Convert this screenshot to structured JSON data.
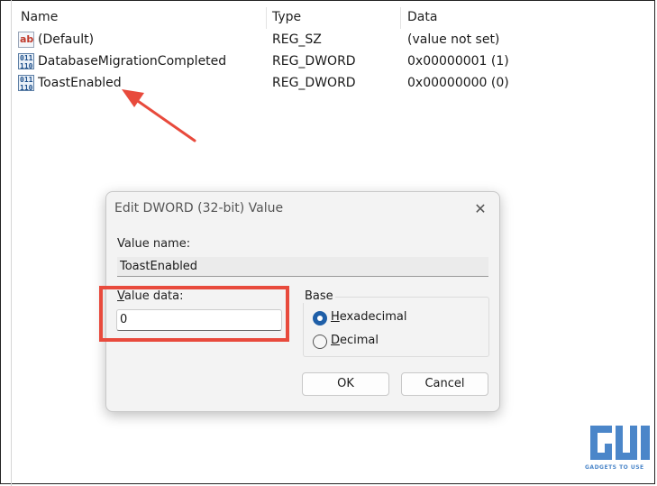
{
  "list": {
    "headers": {
      "name": "Name",
      "type": "Type",
      "data": "Data"
    },
    "rows": [
      {
        "icon": "string-value-icon",
        "icon_text": "ab",
        "name": "(Default)",
        "type": "REG_SZ",
        "data": "(value not set)"
      },
      {
        "icon": "dword-value-icon",
        "icon_text": "011\n110",
        "name": "DatabaseMigrationCompleted",
        "type": "REG_DWORD",
        "data": "0x00000001 (1)"
      },
      {
        "icon": "dword-value-icon",
        "icon_text": "011\n110",
        "name": "ToastEnabled",
        "type": "REG_DWORD",
        "data": "0x00000000 (0)"
      }
    ]
  },
  "dialog": {
    "title": "Edit DWORD (32-bit) Value",
    "value_name_label": "Value name:",
    "value_name": "ToastEnabled",
    "value_data_label_first": "V",
    "value_data_label_rest": "alue data:",
    "value_data": "0",
    "base_label": "Base",
    "radio_hex_first": "H",
    "radio_hex_rest": "exadecimal",
    "radio_dec_first": "D",
    "radio_dec_rest": "ecimal",
    "selected_base": "Hexadecimal",
    "ok": "OK",
    "cancel": "Cancel"
  },
  "colors": {
    "annotation_red": "#e84a3c",
    "radio_accent": "#1f5fa8",
    "logo_blue": "#4b86c9"
  },
  "watermark": {
    "caption": "GADGETS TO USE"
  }
}
